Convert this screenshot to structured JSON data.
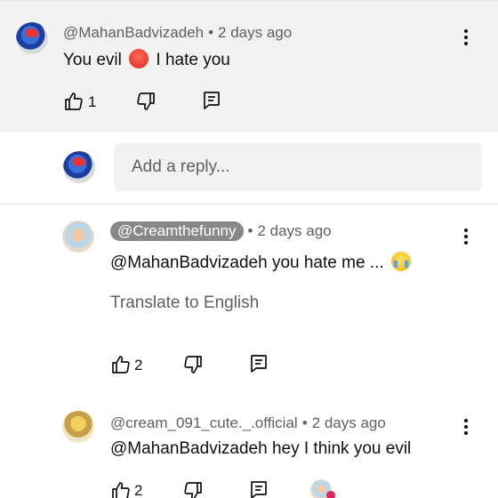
{
  "comments": [
    {
      "handle": "@MahanBadvizadeh",
      "time": "2 days ago",
      "text_before": "You evil",
      "text_after": "I hate you",
      "likes": "1"
    },
    {
      "handle": "@Creamthefunny",
      "time": "2 days ago",
      "text": "@MahanBadvizadeh you hate me ...",
      "translate": "Translate to English",
      "likes": "2"
    },
    {
      "handle": "@cream_091_cute._.official",
      "time": "2 days ago",
      "text": "@MahanBadvizadeh hey I think you evil",
      "likes": "2"
    }
  ],
  "reply": {
    "placeholder": "Add a reply..."
  },
  "separator": "•",
  "icons": {
    "like": "thumbs-up-icon",
    "dislike": "thumbs-down-icon",
    "reply": "reply-comment-icon",
    "more": "more-vert-icon"
  }
}
